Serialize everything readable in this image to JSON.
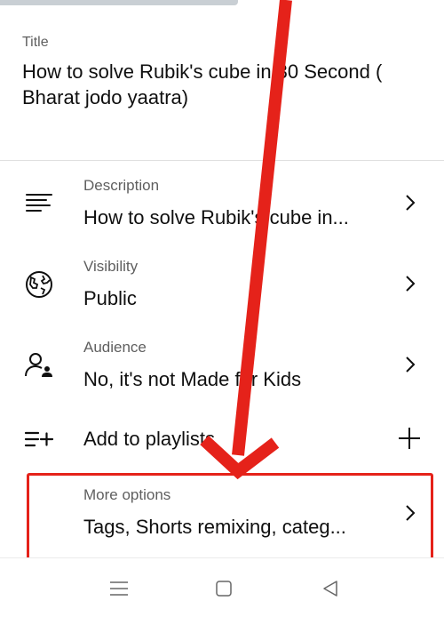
{
  "title_section": {
    "label": "Title",
    "value": "How to solve Rubik's cube in 30 Second ( Bharat jodo yaatra)"
  },
  "rows": {
    "description": {
      "label": "Description",
      "value": "How to solve Rubik's cube in...",
      "icon": "description-lines-icon"
    },
    "visibility": {
      "label": "Visibility",
      "value": "Public",
      "icon": "globe-icon"
    },
    "audience": {
      "label": "Audience",
      "value": "No, it's not Made for Kids",
      "icon": "person-audience-icon"
    },
    "playlist": {
      "value": "Add to playlists",
      "icon": "playlist-add-icon"
    },
    "more_options": {
      "label": "More options",
      "value": "Tags, Shorts remixing, categ..."
    }
  },
  "colors": {
    "annotation": "#e5221a",
    "text_primary": "#0f0f0f",
    "text_secondary": "#5f5f5f"
  },
  "navbar": {
    "icons": [
      "menu-icon",
      "home-square-icon",
      "back-triangle-icon"
    ]
  }
}
